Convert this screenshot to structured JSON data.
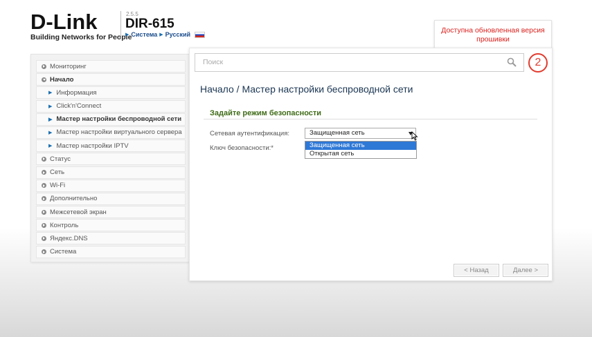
{
  "header": {
    "logo_text": "D-Link",
    "logo_tagline": "Building Networks for People",
    "firmware_version": "2.5.5",
    "model": "DIR-615",
    "system_link": "Система",
    "language_link": "Русский",
    "update_notice": "Доступна обновленная версия прошивки"
  },
  "sidebar": {
    "items": [
      {
        "label": "Мониторинг"
      },
      {
        "label": "Начало"
      },
      {
        "label": "Информация"
      },
      {
        "label": "Click'n'Connect"
      },
      {
        "label": "Мастер настройки беспроводной сети"
      },
      {
        "label": "Мастер настройки виртуального сервера"
      },
      {
        "label": "Мастер настройки IPTV"
      },
      {
        "label": "Статус"
      },
      {
        "label": "Сеть"
      },
      {
        "label": "Wi-Fi"
      },
      {
        "label": "Дополнительно"
      },
      {
        "label": "Межсетевой экран"
      },
      {
        "label": "Контроль"
      },
      {
        "label": "Яндекс.DNS"
      },
      {
        "label": "Система"
      }
    ]
  },
  "search": {
    "placeholder": "Поиск"
  },
  "badge_number": "2",
  "main": {
    "title": "Начало /  Мастер настройки беспроводной сети",
    "section_title": "Задайте режим безопасности",
    "auth_label": "Сетевая аутентификация:",
    "auth_value": "Защищенная сеть",
    "auth_options": [
      "Защищенная сеть",
      "Открытая сеть"
    ],
    "key_label": "Ключ безопасности:*",
    "back_button": "< Назад",
    "next_button": "Далее >"
  },
  "colors": {
    "accent_red": "#d8201c",
    "section_green": "#3f6b17",
    "selected_blue": "#2e78d6"
  }
}
